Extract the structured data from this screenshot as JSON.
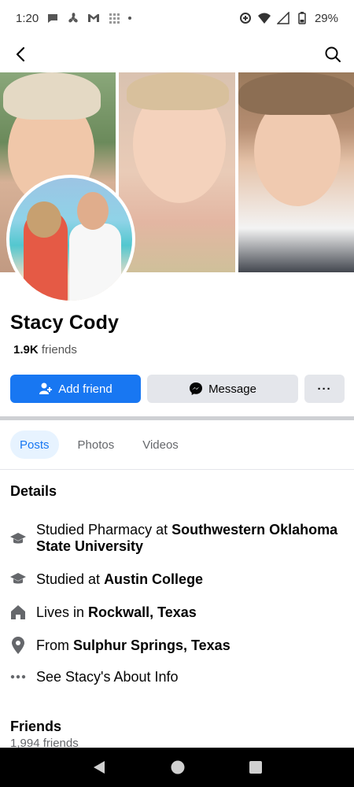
{
  "status_bar": {
    "time": "1:20",
    "battery": "29%"
  },
  "profile": {
    "name": "Stacy Cody",
    "friends_count": "1.9K",
    "friends_label": "friends"
  },
  "actions": {
    "add_friend": "Add friend",
    "message": "Message",
    "more": "···"
  },
  "tabs": [
    {
      "label": "Posts",
      "active": true
    },
    {
      "label": "Photos",
      "active": false
    },
    {
      "label": "Videos",
      "active": false
    }
  ],
  "details": {
    "title": "Details",
    "items": [
      {
        "prefix": "Studied Pharmacy at ",
        "bold": "Southwestern Oklahoma State University",
        "icon": "graduation-cap-icon"
      },
      {
        "prefix": "Studied at ",
        "bold": "Austin College",
        "icon": "graduation-cap-icon"
      },
      {
        "prefix": "Lives in ",
        "bold": "Rockwall, Texas",
        "icon": "home-icon"
      },
      {
        "prefix": "From ",
        "bold": "Sulphur Springs, Texas",
        "icon": "location-pin-icon"
      },
      {
        "prefix": "See Stacy's About Info",
        "bold": "",
        "icon": "more-dots-icon"
      }
    ]
  },
  "friends_section": {
    "title": "Friends",
    "count": "1,994 friends"
  },
  "colors": {
    "accent": "#1877f2",
    "button_gray": "#e4e6eb",
    "tab_active_bg": "#e7f3ff"
  }
}
